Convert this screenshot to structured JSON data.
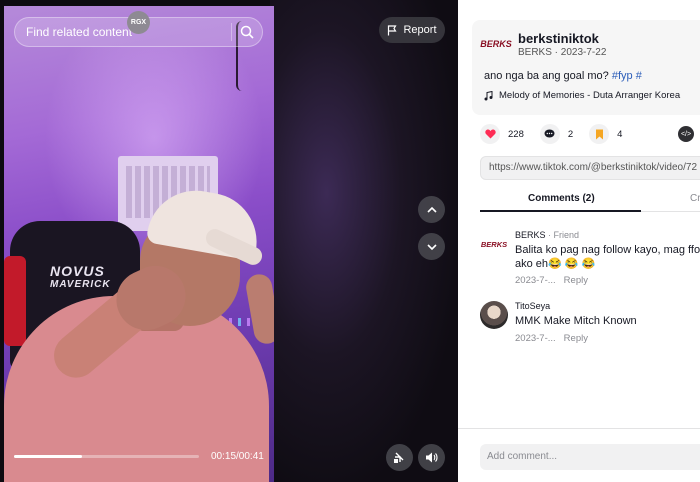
{
  "search": {
    "placeholder": "Find related content",
    "badge": "RGX"
  },
  "report": {
    "label": "Report"
  },
  "player": {
    "time": "00:15/00:41",
    "progress": 0.37
  },
  "video_scene": {
    "chair_brand": "NOVUS",
    "chair_model": "MAVERICK"
  },
  "post": {
    "username": "berkstiniktok",
    "avatar_text": "BERKS",
    "meta": "BERKS · 2023-7-22",
    "caption": "ano nga ba ang goal mo?",
    "tag1": "#fyp",
    "tag2": "#",
    "music": "Melody of Memories - Duta Arranger Korea"
  },
  "actions": {
    "likes": "228",
    "comments": "2",
    "saves": "4"
  },
  "share_url": "https://www.tiktok.com/@berkstiniktok/video/72",
  "tabs": {
    "comments": "Comments (2)",
    "other": "Cr"
  },
  "comments": [
    {
      "avatar_text": "BERKS",
      "name": "BERKS",
      "badge": " · Friend",
      "line1": "Balita ko pag nag follow kayo, mag ffo",
      "line2": "ako eh😂 😂 😂",
      "date": "2023-7-...",
      "reply": "Reply"
    },
    {
      "name": "TitoSeya",
      "line1": "MMK Make Mitch Known",
      "date": "2023-7-...",
      "reply": "Reply"
    }
  ],
  "add_comment": {
    "placeholder": "Add comment..."
  },
  "colors": {
    "accent_like": "#fe2c55",
    "save": "#f5a623",
    "tag": "#2b5db9"
  }
}
